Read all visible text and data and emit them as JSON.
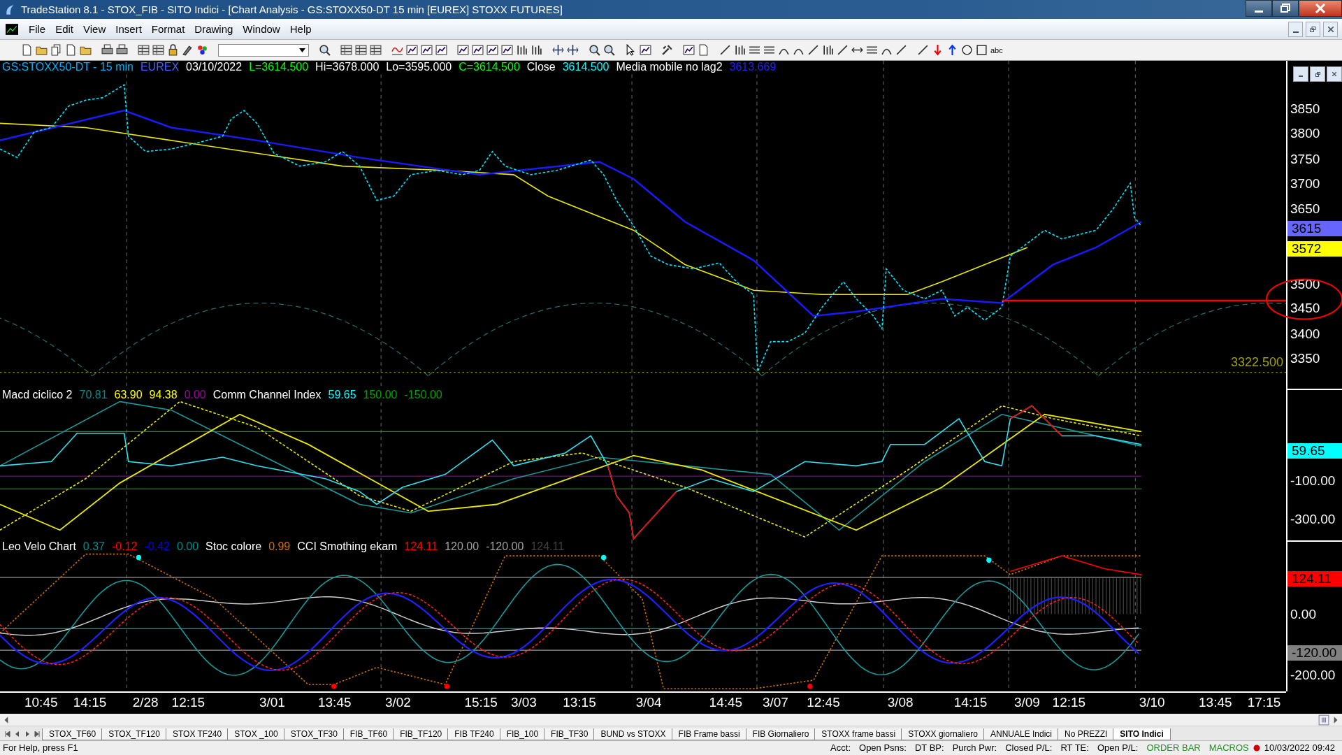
{
  "window": {
    "title": "TradeStation 8.1 - STOX_FIB - SITO Indici - [Chart Analysis - GS:STOXX50-DT  15 min  [EUREX] STOXX FUTURES]"
  },
  "menu": [
    "File",
    "Edit",
    "View",
    "Insert",
    "Format",
    "Drawing",
    "Window",
    "Help"
  ],
  "toolbar": {
    "text_tool": "abc"
  },
  "price_pane": {
    "legend": [
      {
        "text": "GS:STOXX50-DT - 15 min",
        "color": "#00b0ff"
      },
      {
        "text": "EUREX",
        "color": "#4060ff"
      },
      {
        "text": "03/10/2022",
        "color": "#ffffff"
      },
      {
        "text": "L=3614.500",
        "color": "#00ff00"
      },
      {
        "text": "Hi=3678.000",
        "color": "#ffffff"
      },
      {
        "text": "Lo=3595.000",
        "color": "#ffffff"
      },
      {
        "text": "C=3614.500",
        "color": "#00ff00"
      },
      {
        "text": "Close",
        "color": "#ffffff"
      },
      {
        "text": "3614.500",
        "color": "#00ffff"
      },
      {
        "text": "Media mobile no lag2",
        "color": "#ffffff"
      },
      {
        "text": "3613.669",
        "color": "#2020ff"
      }
    ],
    "level_label": "3322.500",
    "axis": [
      "3850",
      "3800",
      "3750",
      "3700",
      "3650",
      "3500",
      "3450",
      "3400",
      "3350"
    ],
    "badges": [
      {
        "text": "3615",
        "color": "#6666ff"
      },
      {
        "text": "3572",
        "color": "#ffff00"
      }
    ]
  },
  "macd_pane": {
    "legend": [
      {
        "text": "Macd ciclico 2",
        "color": "#ffffff"
      },
      {
        "text": "70.81",
        "color": "#008b8b"
      },
      {
        "text": "63.90",
        "color": "#ffff00"
      },
      {
        "text": "94.38",
        "color": "#ffff00"
      },
      {
        "text": "0.00",
        "color": "#a000a0"
      },
      {
        "text": "Comm Channel Index",
        "color": "#ffffff"
      },
      {
        "text": "59.65",
        "color": "#00ffff"
      },
      {
        "text": "150.00",
        "color": "#00a000"
      },
      {
        "text": "-150.00",
        "color": "#00a000"
      }
    ],
    "axis": [
      "-100.00",
      "-300.00"
    ],
    "badges": [
      {
        "text": "59.65",
        "color": "#00ffff"
      }
    ]
  },
  "leo_pane": {
    "legend": [
      {
        "text": "Leo Velo Chart",
        "color": "#ffffff"
      },
      {
        "text": "0.37",
        "color": "#008b8b"
      },
      {
        "text": "-0.12",
        "color": "#ff0000"
      },
      {
        "text": "-0.42",
        "color": "#0000ff"
      },
      {
        "text": "0.00",
        "color": "#008b8b"
      },
      {
        "text": "Stoc colore",
        "color": "#ffffff"
      },
      {
        "text": "0.99",
        "color": "#d07000"
      },
      {
        "text": "CCI Smothing ekam",
        "color": "#ffffff"
      },
      {
        "text": "124.11",
        "color": "#ff0000"
      },
      {
        "text": "120.00",
        "color": "#a0a0a0"
      },
      {
        "text": "-120.00",
        "color": "#a0a0a0"
      },
      {
        "text": "124.11",
        "color": "#404040"
      }
    ],
    "axis": [
      "0.00",
      "-200.00"
    ],
    "badges": [
      {
        "text": "124.11",
        "color": "#ff0000"
      },
      {
        "text": "-120.00",
        "color": "#808080"
      }
    ]
  },
  "time_axis": [
    "10:45",
    "14:15",
    "2/28",
    "12:15",
    "3/01",
    "13:45",
    "3/02",
    "15:15",
    "3/03",
    "13:15",
    "3/04",
    "14:45",
    "3/07",
    "12:45",
    "3/08",
    "14:15",
    "3/09",
    "12:15",
    "3/10",
    "13:45",
    "17:15"
  ],
  "tabs": [
    {
      "label": "STOX_TF60",
      "selected": false
    },
    {
      "label": "STOX_TF120",
      "selected": false
    },
    {
      "label": "STOX TF240",
      "selected": false
    },
    {
      "label": "STOX _100",
      "selected": false
    },
    {
      "label": "STOX_TF30",
      "selected": false
    },
    {
      "label": "FIB_TF60",
      "selected": false
    },
    {
      "label": "FIB_TF120",
      "selected": false
    },
    {
      "label": "FIB TF240",
      "selected": false
    },
    {
      "label": "FIB_100",
      "selected": false
    },
    {
      "label": "FIB_TF30",
      "selected": false
    },
    {
      "label": "BUND vs STOXX",
      "selected": false
    },
    {
      "label": "FIB Frame bassi",
      "selected": false
    },
    {
      "label": "FIB Giornaliero",
      "selected": false
    },
    {
      "label": "STOXX frame bassi",
      "selected": false
    },
    {
      "label": "STOXX giornaliero",
      "selected": false
    },
    {
      "label": "ANNUALE Indici",
      "selected": false
    },
    {
      "label": "No PREZZI",
      "selected": false
    },
    {
      "label": "SITO Indici",
      "selected": true
    }
  ],
  "status_bar": {
    "help": "For Help, press F1",
    "fields": [
      "Acct:",
      "Open Psns:",
      "DT BP:",
      "Purch Pwr:",
      "Closed P/L:",
      "RT TE:",
      "Open P/L:"
    ],
    "order_bar": "ORDER BAR",
    "macros": "MACROS",
    "datetime": "10/03/2022 09:42"
  }
}
